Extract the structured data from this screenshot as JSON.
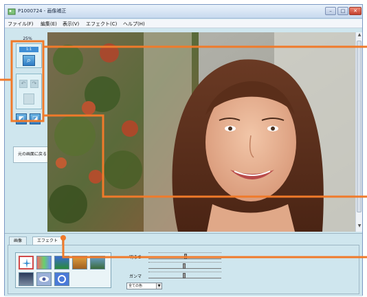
{
  "window": {
    "title": "P1000724 - 画像補正",
    "controls": {
      "minimize": "–",
      "maximize": "□",
      "close": "✕"
    }
  },
  "menu": [
    "ファイル(F)",
    "編集(E)",
    "表示(V)",
    "エフェクト(C)",
    "ヘルプ(H)"
  ],
  "left_panel": {
    "zoom_label": "25%",
    "zoom_bar_text": "1:1",
    "restore_button": "元の画面に戻る"
  },
  "bottom_panel": {
    "tabs": [
      "画像",
      "エフェクト"
    ],
    "sliders": [
      {
        "label": "明るさ",
        "value": 0.52
      },
      {
        "label": "",
        "value": 0.5
      },
      {
        "label": "ガンマ",
        "value": 0.5
      }
    ],
    "color_select": "全ての色"
  },
  "colors": {
    "accent": "#f07a2a",
    "panel": "#cfe6ee",
    "button_blue": "#2f7cc4"
  }
}
